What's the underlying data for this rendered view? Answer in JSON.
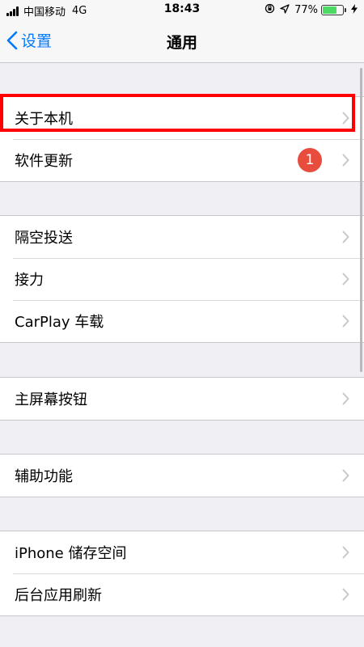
{
  "status_bar": {
    "carrier": "中国移动",
    "network": "4G",
    "time": "18:43",
    "battery_percent": "77%",
    "battery_level": 0.77,
    "icons": [
      "signal-icon",
      "orientation-lock-icon",
      "location-icon",
      "battery-icon",
      "charging-icon"
    ]
  },
  "nav": {
    "back_label": "设置",
    "title": "通用"
  },
  "groups": [
    {
      "items": [
        {
          "label": "关于本机"
        },
        {
          "label": "软件更新",
          "badge": "1"
        }
      ]
    },
    {
      "items": [
        {
          "label": "隔空投送"
        },
        {
          "label": "接力"
        },
        {
          "label": "CarPlay 车载"
        }
      ]
    },
    {
      "items": [
        {
          "label": "主屏幕按钮"
        }
      ]
    },
    {
      "items": [
        {
          "label": "辅助功能"
        }
      ]
    },
    {
      "items": [
        {
          "label": "iPhone 储存空间"
        },
        {
          "label": "后台应用刷新"
        }
      ]
    }
  ],
  "colors": {
    "accent": "#007aff",
    "badge": "#e74c3c",
    "highlight": "#ff0000",
    "background": "#efeff4"
  }
}
